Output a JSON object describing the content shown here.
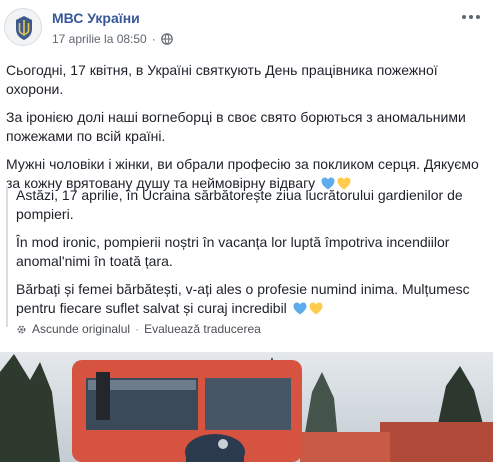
{
  "page": {
    "name": "МВС України",
    "date": "17 aprilie la 08:50",
    "separator": "·"
  },
  "post": {
    "paragraphs": [
      "Сьогодні, 17 квітня, в Україні святкують День працівника пожежної охорони.",
      "За іронією долі наші вогneборці в своє свято борються з аномальними пожежами по всій країні.",
      "Мужні чоловіки і жінки, ви обрали професію за покликом серця. Дякуємо за кожну врятовану душу та неймовірну відвагу"
    ]
  },
  "translation": {
    "paragraphs": [
      "Astăzi, 17 aprilie, în Ucraina sărbătorește ziua lucrătorului gardienilor de pompieri.",
      "În mod ironic, pompierii noștri în vacanța lor luptă împotriva incendiilor anomal'nimi în toată țara.",
      "Bărbați și femei bărbătești, v-ați ales o profesie numind inima. Mulțumesc pentru fiecare suflet salvat și curaj incredibil"
    ],
    "hide_original": "Ascunde originalul",
    "separator": "·",
    "rate": "Evaluează traducerea"
  },
  "icons": {
    "avatar": "coat-of-arms-icon",
    "privacy": "globe-icon",
    "more": "more-options-icon",
    "hearts": [
      "blue-heart-icon",
      "yellow-heart-icon"
    ],
    "settings": "gear-icon"
  },
  "colors": {
    "page_name": "#385898",
    "text": "#1d2129",
    "meta": "#606770",
    "heart_blue": "#5dadec",
    "heart_yellow": "#ffcc4d"
  }
}
